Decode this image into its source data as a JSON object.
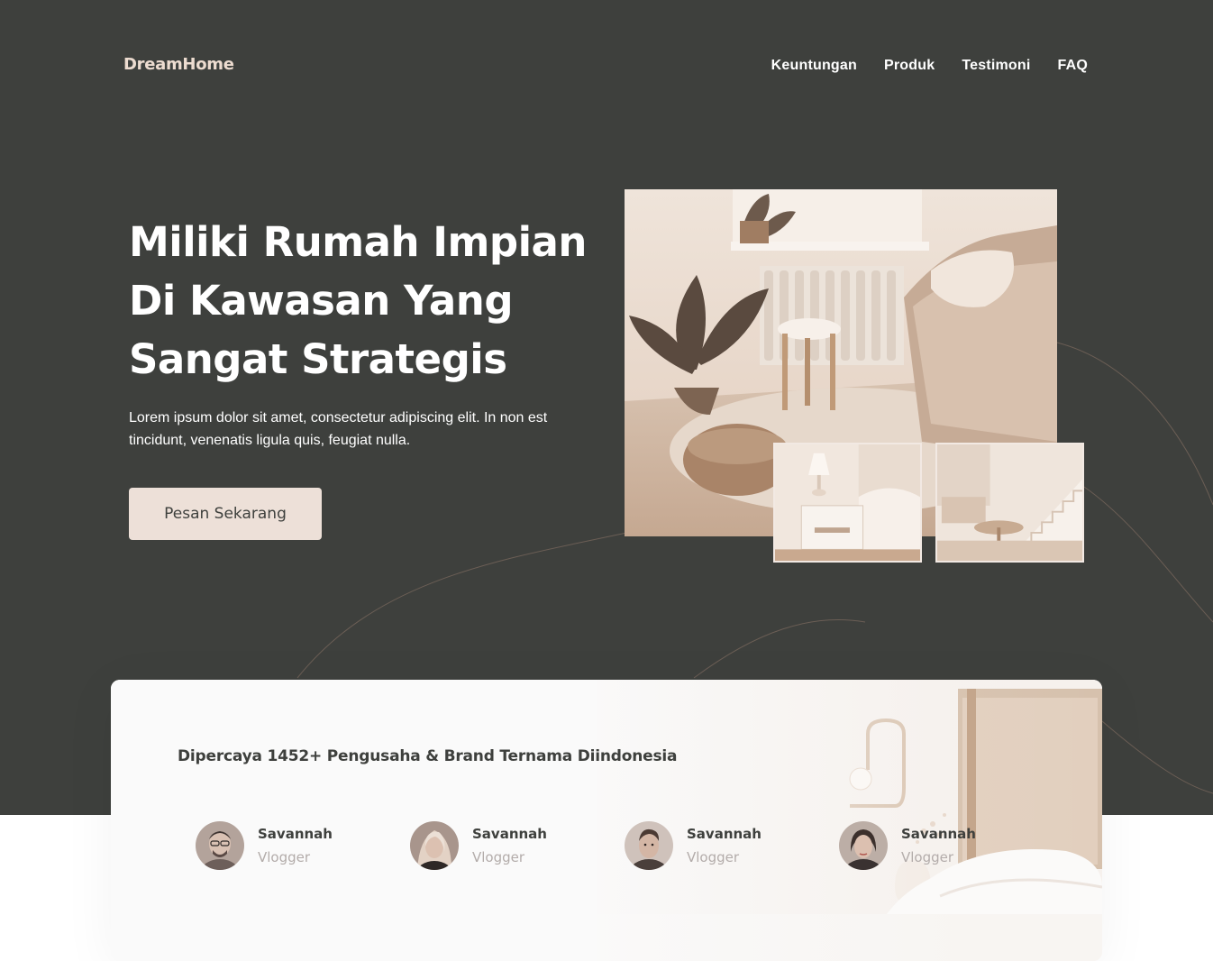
{
  "brand": {
    "logo": "DreamHome"
  },
  "nav": {
    "items": [
      "Keuntungan",
      "Produk",
      "Testimoni",
      "FAQ"
    ]
  },
  "hero": {
    "title_line1": "Miliki Rumah Impian",
    "title_line2": "Di Kawasan Yang",
    "title_line3": "Sangat Strategis",
    "description": "Lorem ipsum dolor sit amet, consectetur adipiscing elit. In non est tincidunt, venenatis ligula quis, feugiat nulla.",
    "cta_label": "Pesan Sekarang"
  },
  "trust": {
    "title": "Dipercaya 1452+ Pengusaha & Brand Ternama Diindonesia",
    "testimonials": [
      {
        "name": "Savannah",
        "role": "Vlogger"
      },
      {
        "name": "Savannah",
        "role": "Vlogger"
      },
      {
        "name": "Savannah",
        "role": "Vlogger"
      },
      {
        "name": "Savannah",
        "role": "Vlogger"
      }
    ]
  },
  "colors": {
    "hero_bg": "#3e403d",
    "accent": "#ede0d8",
    "logo": "#eddcd0",
    "muted_text": "#b3acaa"
  }
}
